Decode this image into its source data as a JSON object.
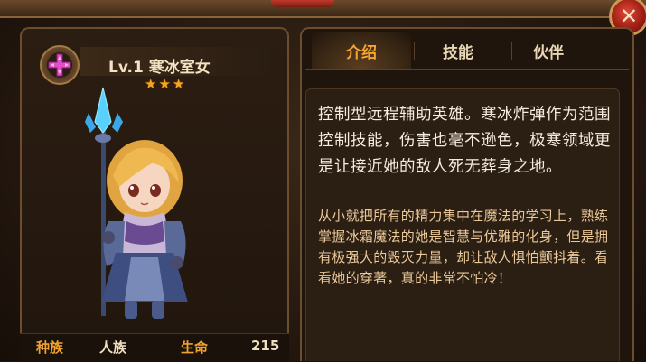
{
  "hero": {
    "title": "Lv.1 寒冰室女",
    "stars": 3,
    "class_icon": "cross-emblem-icon"
  },
  "stats": {
    "race_label": "种族",
    "race_value": "人族",
    "hp_label": "生命",
    "hp_value": "215"
  },
  "tabs": [
    {
      "label": "介绍",
      "active": true
    },
    {
      "label": "技能",
      "active": false
    },
    {
      "label": "伙伴",
      "active": false
    }
  ],
  "description": {
    "main": "控制型远程辅助英雄。寒冰炸弹作为范围控制技能，伤害也毫不逊色，极寒领域更是让接近她的敌人死无葬身之地。",
    "lore": "从小就把所有的精力集中在魔法的学习上，熟练掌握冰霜魔法的她是智慧与优雅的化身，但是拥有极强大的毁灭力量，却让敌人惧怕颤抖着。看看她的穿著，真的非常不怕冷！"
  },
  "close_icon": "close-icon",
  "colors": {
    "accent": "#f5a530",
    "label": "#f0a330",
    "value": "#f0e0c0",
    "star": "#f3a622"
  }
}
